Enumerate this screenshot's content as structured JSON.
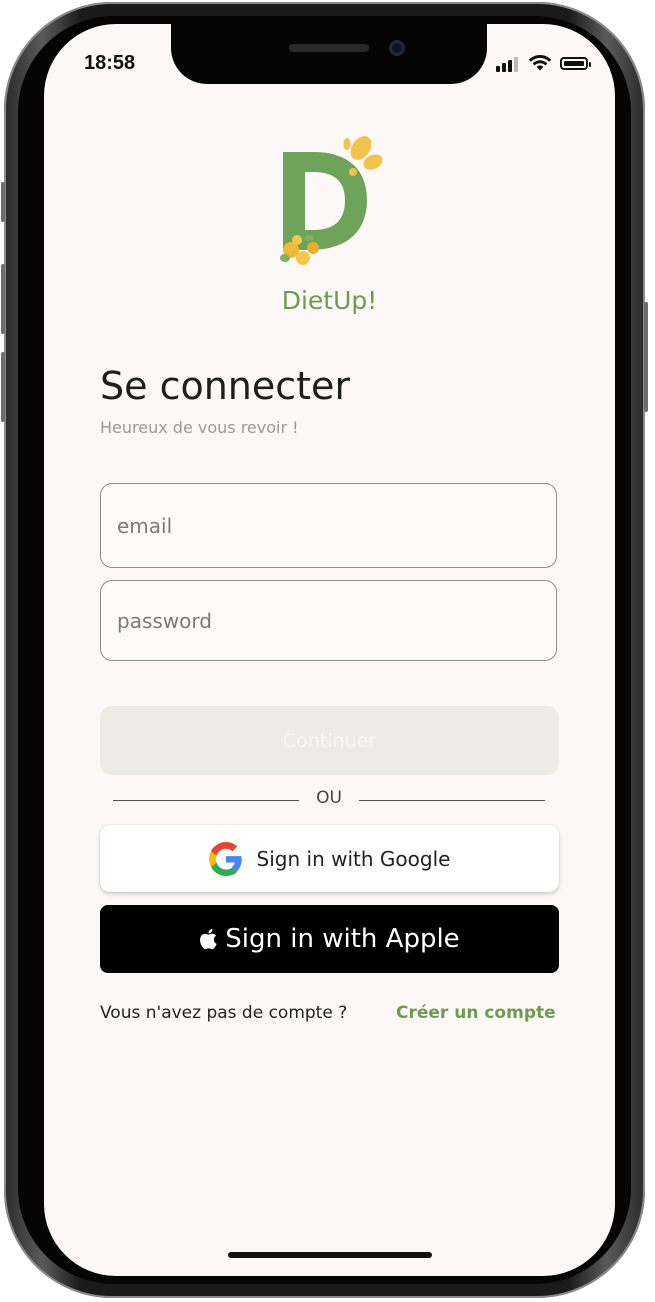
{
  "status_bar": {
    "time": "18:58",
    "icons": [
      "cellular-signal-icon",
      "wifi-icon",
      "battery-icon"
    ]
  },
  "app": {
    "name": "DietUp!",
    "brand_color": "#6e9c4e",
    "accent_color": "#f2c24b"
  },
  "login": {
    "title": "Se connecter",
    "subtitle": "Heureux de vous revoir !",
    "email_placeholder": "email",
    "password_placeholder": "password",
    "continue_label": "Continuer",
    "separator": "OU",
    "google_label": "Sign in with Google",
    "apple_label": "Sign in with Apple",
    "no_account_text": "Vous n'avez pas de compte ?",
    "create_account_label": "Créer un compte"
  }
}
